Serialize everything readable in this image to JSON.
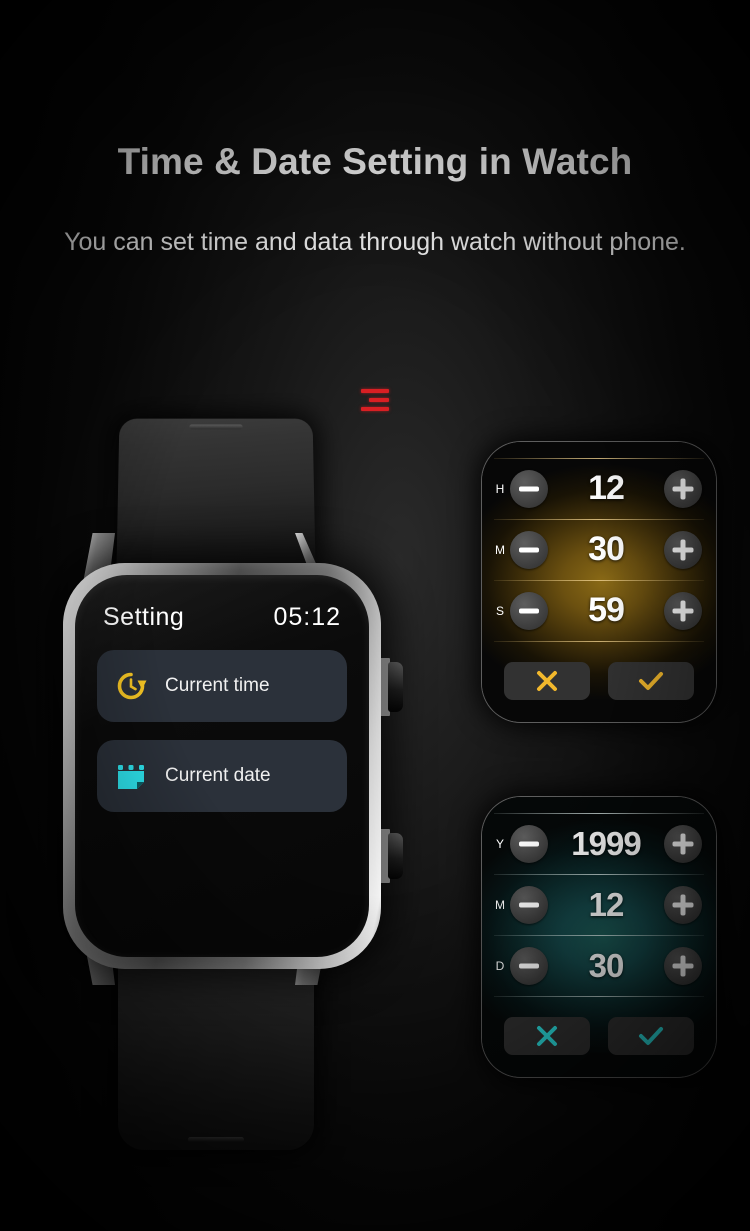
{
  "page": {
    "title": "Time & Date Setting in Watch",
    "subtitle": "You can set time and data through watch without phone."
  },
  "marker": {
    "name": "red-bars-mark",
    "color": "#d81f23",
    "bars": 3
  },
  "watch": {
    "screen": {
      "header_label": "Setting",
      "header_time": "05:12",
      "items": [
        {
          "icon": "clock-restore-icon",
          "icon_color": "#F5C524",
          "label": "Current time"
        },
        {
          "icon": "calendar-icon",
          "icon_color": "#2EE6F0",
          "label": "Current date"
        }
      ]
    },
    "side_buttons": [
      "crown-button-upper",
      "crown-button-lower"
    ]
  },
  "panels": [
    {
      "id": "time",
      "accent": "#F2B82C",
      "glow": "#8a6a16",
      "rows": [
        {
          "label": "H",
          "value": "12",
          "minus": "minus-button",
          "plus": "plus-button"
        },
        {
          "label": "M",
          "value": "30",
          "minus": "minus-button",
          "plus": "plus-button"
        },
        {
          "label": "S",
          "value": "59",
          "minus": "minus-button",
          "plus": "plus-button"
        }
      ],
      "actions": {
        "cancel": "cancel-button",
        "confirm": "confirm-button"
      }
    },
    {
      "id": "date",
      "accent": "#2DE6E6",
      "glow": "#1c5b56",
      "rows": [
        {
          "label": "Y",
          "value": "1999",
          "minus": "minus-button",
          "plus": "plus-button"
        },
        {
          "label": "M",
          "value": "12",
          "minus": "minus-button",
          "plus": "plus-button"
        },
        {
          "label": "D",
          "value": "30",
          "minus": "minus-button",
          "plus": "plus-button"
        }
      ],
      "actions": {
        "cancel": "cancel-button",
        "confirm": "confirm-button"
      }
    }
  ]
}
